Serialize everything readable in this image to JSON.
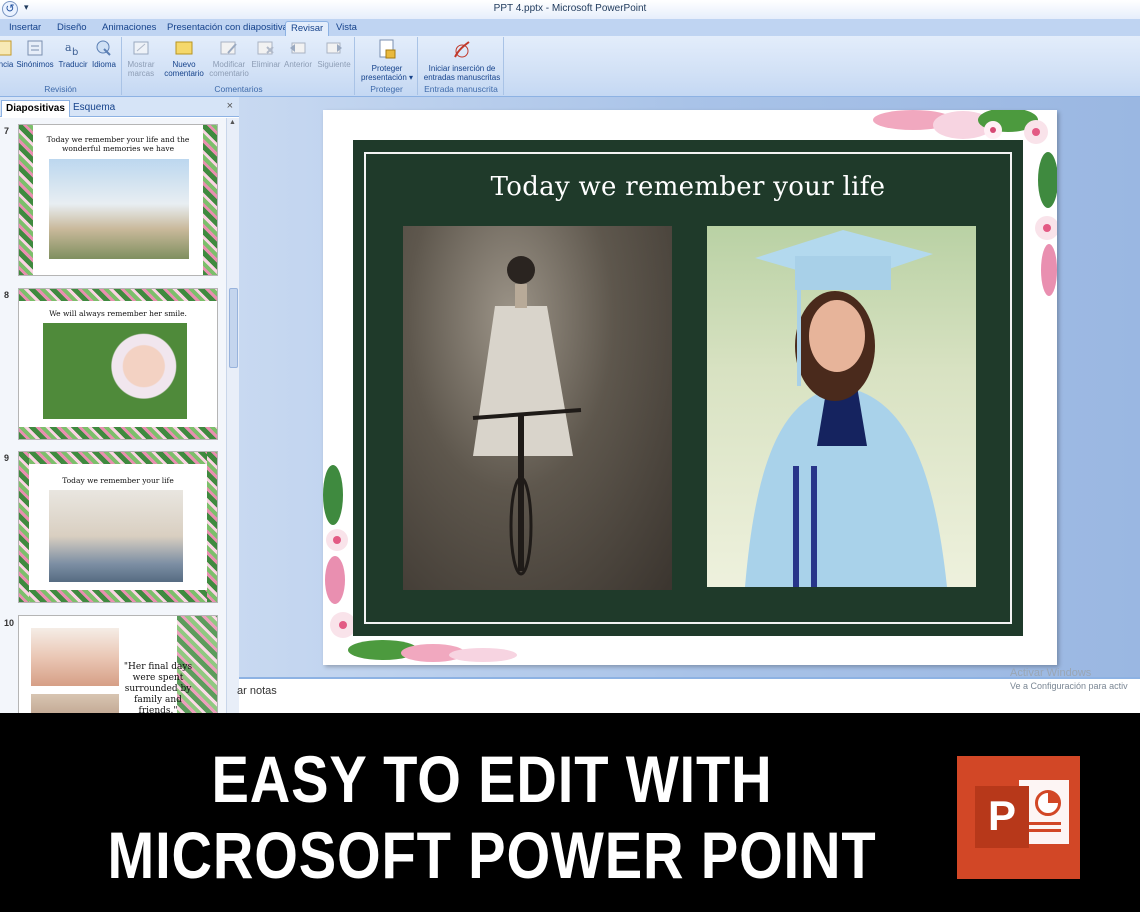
{
  "window": {
    "title": "PPT 4.pptx - Microsoft PowerPoint",
    "qa_icon": "undo-icon",
    "qa_more": "▾"
  },
  "ribbon_tabs": [
    "Insertar",
    "Diseño",
    "Animaciones",
    "Presentación con diapositivas",
    "Revisar",
    "Vista"
  ],
  "active_tab": "Revisar",
  "ribbon": {
    "revision": {
      "label": "Revisión",
      "buttons": [
        "ncia",
        "Sinónimos",
        "Traducir",
        "Idioma"
      ]
    },
    "comentarios": {
      "label": "Comentarios",
      "buttons": [
        "Mostrar marcas",
        "Nuevo comentario",
        "Modificar comentario",
        "Eliminar",
        "Anterior",
        "Siguiente"
      ]
    },
    "proteger": {
      "label": "Proteger",
      "buttons": [
        "Proteger presentación"
      ]
    },
    "manuscrita": {
      "label": "Entrada manuscrita",
      "buttons": [
        "Iniciar inserción de entradas manuscritas"
      ]
    }
  },
  "panel": {
    "tabs": [
      "Diapositivas",
      "Esquema"
    ],
    "close": "×"
  },
  "thumbnails": [
    {
      "num": "7",
      "title": "Today we remember your life and the wonderful memories we have"
    },
    {
      "num": "8",
      "title": "We will always remember her smile."
    },
    {
      "num": "9",
      "title": "Today we remember your life"
    },
    {
      "num": "10",
      "title": "\"Her final days were spent surrounded by family and friends.\""
    }
  ],
  "slide": {
    "title": "Today we remember your life"
  },
  "notes": {
    "placeholder": "ar notas"
  },
  "watermark": {
    "line1": "Activar Windows",
    "line2": "Ve a Configuración para activ"
  },
  "banner": {
    "line1": "EASY TO EDIT WITH",
    "line2": "MICROSOFT POWER POINT",
    "logo_letter": "P"
  },
  "colors": {
    "slide_green": "#1f3a2a",
    "ppt_orange": "#d24726",
    "ribbon_blue": "#bfd4f2"
  }
}
